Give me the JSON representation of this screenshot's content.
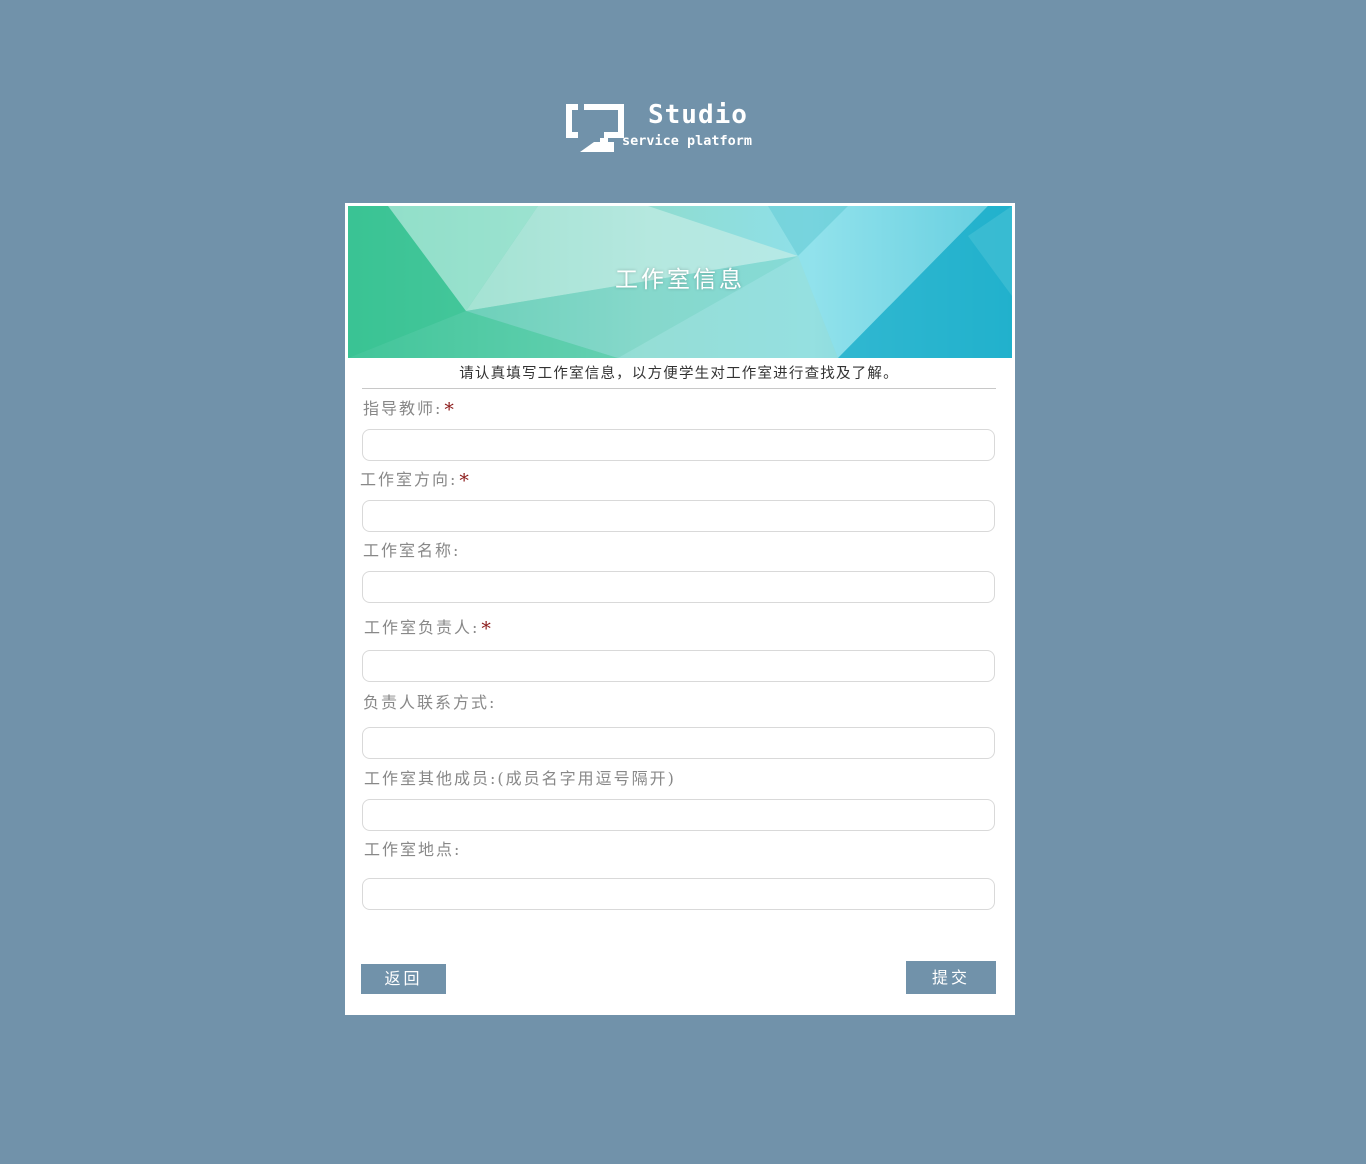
{
  "logo": {
    "title": "Studio",
    "subtitle": "service platform",
    "icon": "monitor-bracket-icon"
  },
  "banner": {
    "title": "工作室信息"
  },
  "intro": "请认真填写工作室信息，以方便学生对工作室进行查找及了解。",
  "required_mark": "*",
  "fields": [
    {
      "label": "指导教师:",
      "required": true,
      "value": "",
      "placeholder": ""
    },
    {
      "label": "工作室方向:",
      "required": true,
      "value": "",
      "placeholder": ""
    },
    {
      "label": "工作室名称:",
      "required": false,
      "value": "",
      "placeholder": ""
    },
    {
      "label": "工作室负责人:",
      "required": true,
      "value": "",
      "placeholder": ""
    },
    {
      "label": "负责人联系方式:",
      "required": false,
      "value": "",
      "placeholder": ""
    },
    {
      "label": "工作室其他成员:(成员名字用逗号隔开)",
      "required": false,
      "value": "",
      "placeholder": ""
    },
    {
      "label": "工作室地点:",
      "required": false,
      "value": "",
      "placeholder": ""
    }
  ],
  "buttons": {
    "back": "返回",
    "submit": "提交"
  },
  "colors": {
    "page_background": "#7192aa",
    "button": "#7192aa",
    "required": "#8b1a1a",
    "banner_left": "#2fbf8c",
    "banner_right": "#1fb0cc"
  }
}
